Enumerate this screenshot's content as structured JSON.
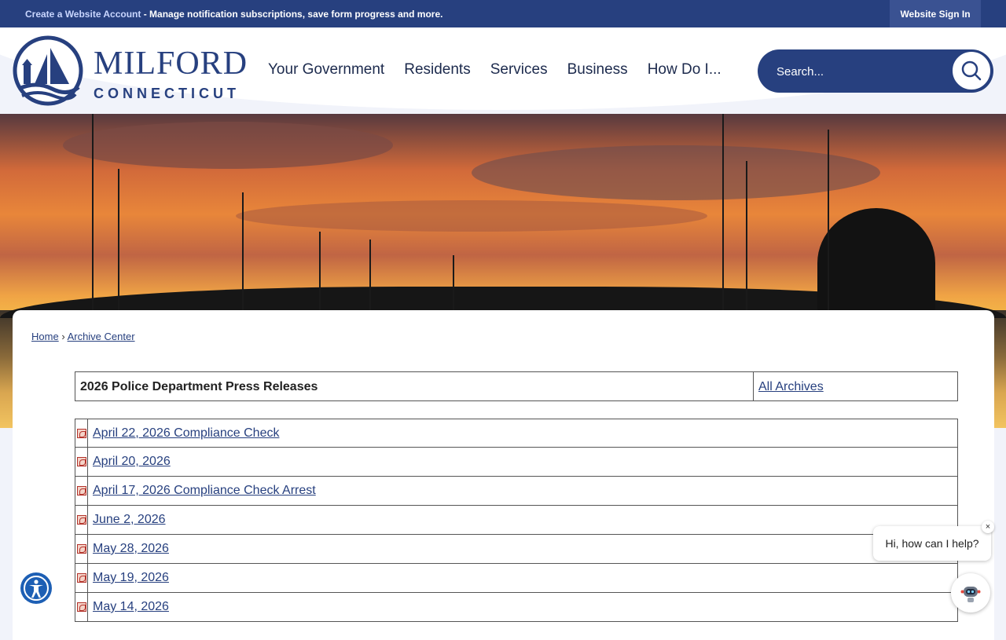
{
  "topbar": {
    "create_link": "Create a Website Account",
    "promo_rest": " - Manage notification subscriptions, save form progress and more.",
    "sign_in": "Website Sign In"
  },
  "logo": {
    "name": "MILFORD",
    "state": "CONNECTICUT"
  },
  "nav": {
    "items": [
      {
        "label": "Your Government"
      },
      {
        "label": "Residents"
      },
      {
        "label": "Services"
      },
      {
        "label": "Business"
      },
      {
        "label": "How Do I..."
      }
    ]
  },
  "search": {
    "placeholder": "Search..."
  },
  "breadcrumb": {
    "home": "Home",
    "separator": "›",
    "current": "Archive Center"
  },
  "archive": {
    "title": "2026 Police Department Press Releases",
    "all_archives": "All Archives",
    "items": [
      {
        "label": "April 22, 2026 Compliance Check"
      },
      {
        "label": "April 20, 2026"
      },
      {
        "label": "April 17, 2026 Compliance Check Arrest"
      },
      {
        "label": "June 2, 2026"
      },
      {
        "label": "May 28, 2026"
      },
      {
        "label": "May 19, 2026"
      },
      {
        "label": "May 14, 2026"
      }
    ]
  },
  "chat": {
    "greeting": "Hi, how can I help?",
    "close": "×"
  },
  "colors": {
    "brand": "#27407f",
    "link": "#27407f",
    "accessibility": "#1d5fb4"
  },
  "icons": {
    "search": "search-icon",
    "pdf": "pdf-icon",
    "accessibility": "accessibility-icon",
    "chatbot": "chatbot-icon"
  }
}
